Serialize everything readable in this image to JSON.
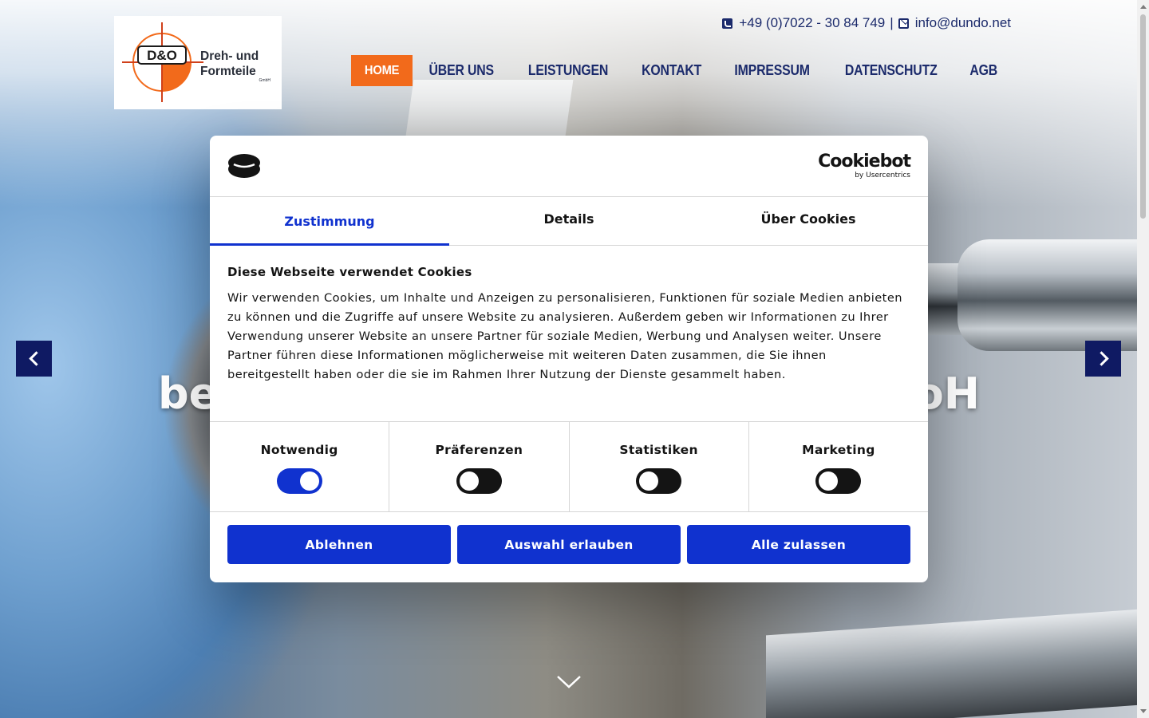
{
  "colors": {
    "accent": "#f26a1b",
    "nav_text": "#1b2a6b",
    "cookiebot_blue": "#1032cf",
    "arrow_bg": "#0f1a63"
  },
  "header": {
    "logo": {
      "brand": "D&O",
      "line1": "Dreh- und",
      "line2": "Formteile",
      "line3": "GmbH"
    },
    "contact": {
      "phone_icon": "phone-square-icon",
      "phone": "+49 (0)7022 - 30 84 749",
      "separator": "|",
      "mail_icon": "envelope-icon",
      "email": "info@dundo.net"
    },
    "nav": [
      {
        "label": "HOME",
        "active": true
      },
      {
        "label": "ÜBER UNS"
      },
      {
        "label": "LEISTUNGEN"
      },
      {
        "label": "KONTAKT"
      },
      {
        "label": "IMPRESSUM"
      },
      {
        "label": "DATENSCHUTZ"
      },
      {
        "label": "AGB"
      }
    ]
  },
  "hero": {
    "title_left": "be",
    "title_right": "oH",
    "prev_icon": "chevron-left-icon",
    "next_icon": "chevron-right-icon",
    "scroll_icon": "chevron-down-icon"
  },
  "cookie_dialog": {
    "brand_name": "Cookiebot",
    "brand_sub": "by Usercentrics",
    "tabs": [
      {
        "label": "Zustimmung",
        "active": true
      },
      {
        "label": "Details"
      },
      {
        "label": "Über Cookies"
      }
    ],
    "heading": "Diese Webseite verwendet Cookies",
    "text": "Wir verwenden Cookies, um Inhalte und Anzeigen zu personalisieren, Funktionen für soziale Medien anbieten zu können und die Zugriffe auf unsere Website zu analysieren. Außerdem geben wir Informationen zu Ihrer Verwendung unserer Website an unsere Partner für soziale Medien, Werbung und Analysen weiter. Unsere Partner führen diese Informationen möglicherweise mit weiteren Daten zusammen, die Sie ihnen bereitgestellt haben oder die sie im Rahmen Ihrer Nutzung der Dienste gesammelt haben.",
    "toggles": [
      {
        "label": "Notwendig",
        "on": true
      },
      {
        "label": "Präferenzen",
        "on": false
      },
      {
        "label": "Statistiken",
        "on": false
      },
      {
        "label": "Marketing",
        "on": false
      }
    ],
    "buttons": {
      "decline": "Ablehnen",
      "allow_selection": "Auswahl erlauben",
      "allow_all": "Alle zulassen"
    }
  }
}
